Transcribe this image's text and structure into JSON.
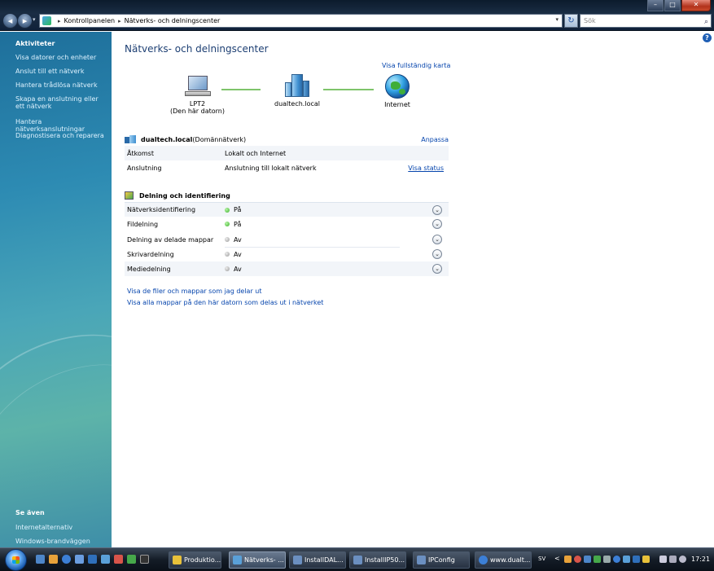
{
  "window": {
    "min": "–",
    "max": "□",
    "close": "✕"
  },
  "address": {
    "sep1": "▸",
    "crumb1": "Kontrollpanelen",
    "sep2": "▸",
    "crumb2": "Nätverks- och delningscenter",
    "drop": "▾",
    "refresh": "↻",
    "search_placeholder": "Sök",
    "search_icon": "⌕"
  },
  "sidebar": {
    "tasks_heading": "Aktiviteter",
    "tasks": [
      "Visa datorer och enheter",
      "Anslut till ett nätverk",
      "Hantera trådlösa nätverk",
      "Skapa en anslutning eller ett nätverk",
      "Hantera nätverksanslutningar",
      "Diagnostisera och reparera"
    ],
    "see_also_heading": "Se även",
    "see_also": [
      "Internetalternativ",
      "Windows-brandväggen"
    ]
  },
  "main": {
    "help": "?",
    "title": "Nätverks- och delningscenter",
    "full_map_link": "Visa fullständig karta",
    "map": {
      "computer_name": "LPT2",
      "computer_sub": "(Den här datorn)",
      "network_name": "dualtech.local",
      "internet_name": "Internet"
    },
    "network": {
      "name": "dualtech.local",
      "type": " (Domännätverk)",
      "customize": "Anpassa",
      "access_label": "Åtkomst",
      "access_value": "Lokalt och Internet",
      "conn_label": "Anslutning",
      "conn_value": "Anslutning till lokalt nätverk",
      "status_link": "Visa status"
    },
    "sharing": {
      "heading": "Delning och identifiering",
      "expand": "⌄",
      "rows": [
        {
          "label": "Nätverksidentifiering",
          "state": "På",
          "on": true
        },
        {
          "label": "Fildelning",
          "state": "På",
          "on": true
        },
        {
          "label": "Delning av delade mappar",
          "state": "Av",
          "on": false
        },
        {
          "label": "Skrivardelning",
          "state": "Av",
          "on": false
        },
        {
          "label": "Mediedelning",
          "state": "Av",
          "on": false
        }
      ]
    },
    "footer_links": [
      "Visa de filer och mappar som jag delar ut",
      "Visa alla mappar på den här datorn som delas ut i nätverket"
    ]
  },
  "taskbar": {
    "tasks": [
      "Produktio...",
      "Nätverks- ...",
      "InstallDAL...",
      "InstallIP50...",
      "IPConfig",
      "www.dualt..."
    ],
    "language": "SV",
    "tray_arrow": "<",
    "clock": "17:21"
  },
  "colors": {
    "link": "#0645ad",
    "title": "#1d3f73",
    "status_on": "#3bb02a",
    "status_off": "#999999"
  }
}
